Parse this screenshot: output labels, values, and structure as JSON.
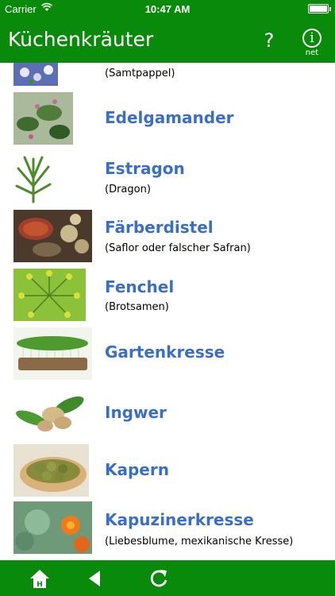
{
  "status_bar": {
    "carrier": "Carrier",
    "time": "10:47 AM"
  },
  "nav": {
    "title": "Küchenkräuter",
    "help_label": "?",
    "info_label": "i",
    "info_sub": "net"
  },
  "colors": {
    "bar_green": "#0a8a0a",
    "title_blue": "#3a6fc3"
  },
  "list": [
    {
      "title": "",
      "subtitle": "(Samtpappel)",
      "image": "samtpappel-flower-photo"
    },
    {
      "title": "Edelgamander",
      "subtitle": "",
      "image": "edelgamander-plant-photo"
    },
    {
      "title": "Estragon",
      "subtitle": "(Dragon)",
      "image": "estragon-plant-photo"
    },
    {
      "title": "Färberdistel",
      "subtitle": "(Saflor oder falscher Safran)",
      "image": "faerberdistel-photo"
    },
    {
      "title": "Fenchel",
      "subtitle": "(Brotsamen)",
      "image": "fenchel-photo"
    },
    {
      "title": "Gartenkresse",
      "subtitle": "",
      "image": "gartenkresse-photo"
    },
    {
      "title": "Ingwer",
      "subtitle": "",
      "image": "ingwer-photo"
    },
    {
      "title": "Kapern",
      "subtitle": "",
      "image": "kapern-photo"
    },
    {
      "title": "Kapuzinerkresse",
      "subtitle": "(Liebesblume, mexikanische Kresse)",
      "image": "kapuzinerkresse-photo"
    }
  ],
  "toolbar": {
    "icons": [
      "home-icon",
      "back-icon",
      "refresh-icon"
    ]
  }
}
